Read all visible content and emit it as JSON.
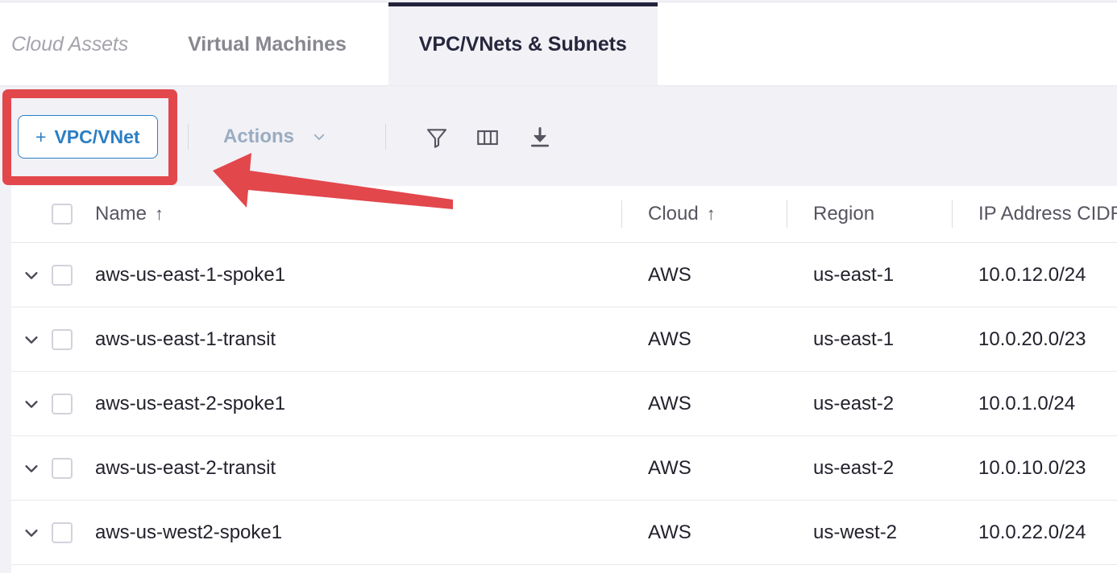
{
  "tabs": [
    {
      "label": "Cloud Assets",
      "state": "muted",
      "name": "tab-cloud-assets"
    },
    {
      "label": "Virtual Machines",
      "state": "inactive",
      "name": "tab-virtual-machines"
    },
    {
      "label": "VPC/VNets & Subnets",
      "state": "active",
      "name": "tab-vpc-vnets-subnets"
    }
  ],
  "toolbar": {
    "new_button": {
      "plus": "+",
      "label": "VPC/VNet"
    },
    "actions": {
      "label": "Actions",
      "chevron": "chevron-down-icon"
    },
    "icons": [
      {
        "name": "filter-icon",
        "title": "Filter"
      },
      {
        "name": "columns-icon",
        "title": "Columns"
      },
      {
        "name": "download-icon",
        "title": "Download"
      }
    ]
  },
  "table": {
    "select_all_checkbox": "unchecked",
    "columns": [
      {
        "key": "name",
        "label": "Name",
        "sort": "↑"
      },
      {
        "key": "cloud",
        "label": "Cloud",
        "sort": "↑"
      },
      {
        "key": "region",
        "label": "Region",
        "sort": ""
      },
      {
        "key": "cidr",
        "label": "IP Address CIDR",
        "sort": ""
      }
    ],
    "rows": [
      {
        "name": "aws-us-east-1-spoke1",
        "cloud": "AWS",
        "region": "us-east-1",
        "cidr": "10.0.12.0/24"
      },
      {
        "name": "aws-us-east-1-transit",
        "cloud": "AWS",
        "region": "us-east-1",
        "cidr": "10.0.20.0/23"
      },
      {
        "name": "aws-us-east-2-spoke1",
        "cloud": "AWS",
        "region": "us-east-2",
        "cidr": "10.0.1.0/24"
      },
      {
        "name": "aws-us-east-2-transit",
        "cloud": "AWS",
        "region": "us-east-2",
        "cidr": "10.0.10.0/23"
      },
      {
        "name": "aws-us-west2-spoke1",
        "cloud": "AWS",
        "region": "us-west-2",
        "cidr": "10.0.22.0/24"
      }
    ]
  },
  "annotations": {
    "highlight_color": "#e2474c",
    "highlight_target": "+ VPC/VNet",
    "arrow_direction": "left"
  },
  "colors": {
    "accent_blue": "#2b7fc4",
    "active_tab_bg": "#f1f1f6",
    "active_tab_border": "#22223c",
    "annotation_red": "#e2474c",
    "text_primary": "#22222c",
    "text_muted": "#87878f"
  }
}
